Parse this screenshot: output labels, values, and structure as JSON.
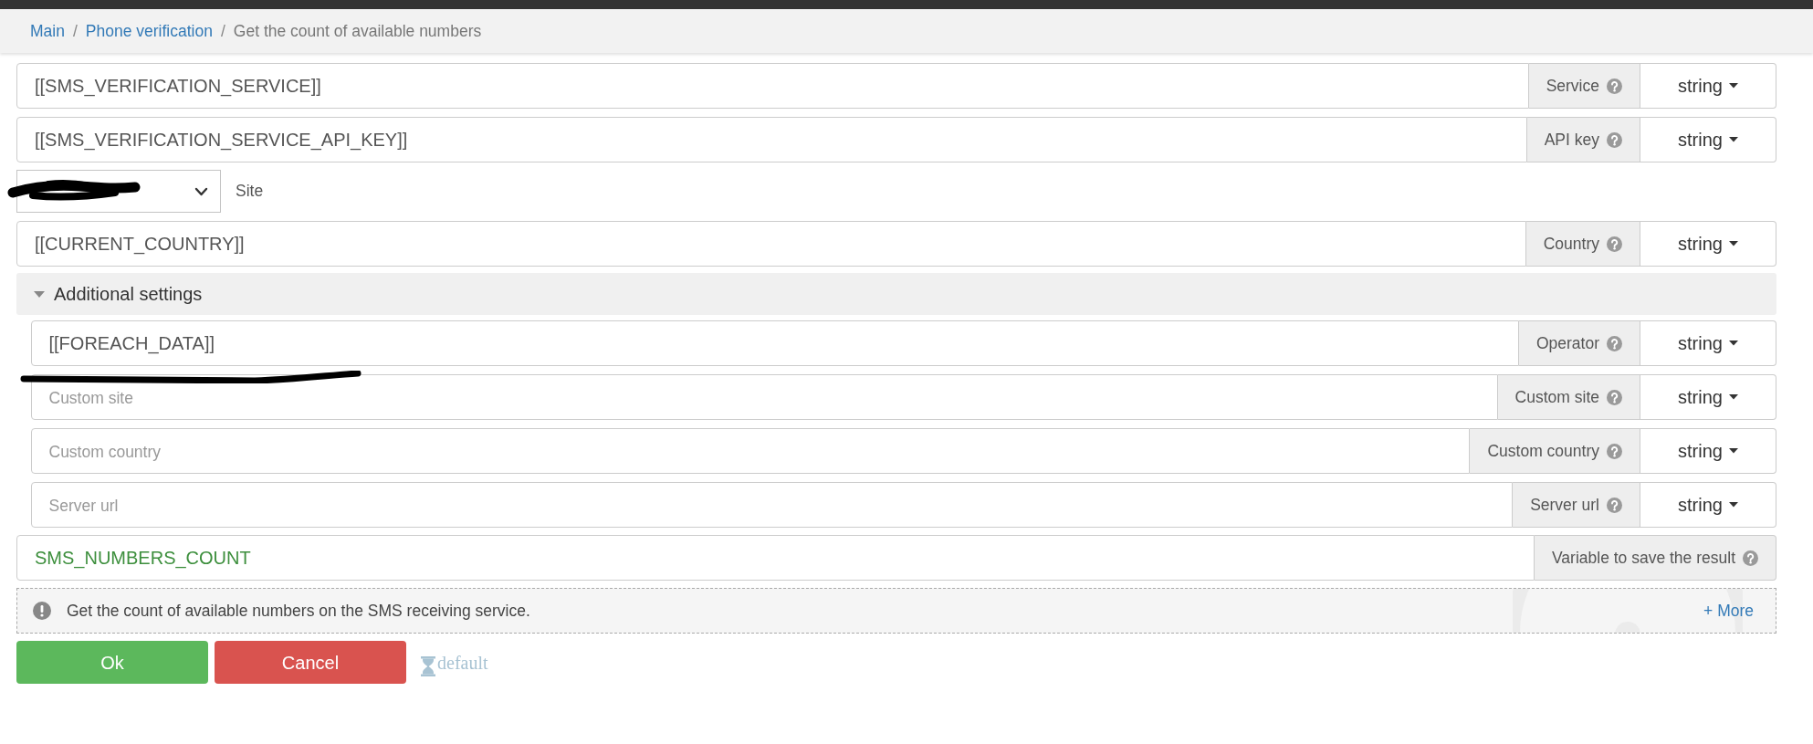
{
  "breadcrumb": [
    {
      "kind": "link",
      "label": "Main"
    },
    {
      "kind": "separator",
      "label": "/"
    },
    {
      "kind": "link",
      "label": "Phone verification"
    },
    {
      "kind": "separator",
      "label": "/"
    },
    {
      "kind": "current",
      "label": "Get the count of available numbers"
    }
  ],
  "fields": [
    {
      "value": "[[SMS_VERIFICATION_SERVICE]]",
      "label": "Service",
      "type": "string"
    },
    {
      "value": "[[SMS_VERIFICATION_SERVICE_API_KEY]]",
      "label": "API key",
      "type": "string"
    }
  ],
  "site_select": {
    "label": "Site",
    "redacted": true
  },
  "country_field": {
    "value": "[[CURRENT_COUNTRY]]",
    "label": "Country",
    "type": "string"
  },
  "additional_settings": {
    "label": "Additional settings",
    "expanded": true,
    "fields": [
      {
        "value": "[[FOREACH_DATA]]",
        "label": "Operator",
        "type": "string",
        "redacted": true
      },
      {
        "placeholder": "Custom site",
        "label": "Custom site",
        "type": "string",
        "redacted": false
      },
      {
        "placeholder": "Custom country",
        "label": "Custom country",
        "type": "string",
        "redacted": false
      },
      {
        "placeholder": "Server url",
        "label": "Server url",
        "type": "string",
        "redacted": false
      }
    ]
  },
  "result_variable": {
    "value": "SMS_NUMBERS_COUNT",
    "label": "Variable to save the result"
  },
  "info": {
    "text": "Get the count of available numbers on the SMS receiving service.",
    "more_link": "+ More"
  },
  "buttons": [
    {
      "kind": "ok",
      "label": "Ok"
    },
    {
      "kind": "cancel",
      "label": "Cancel"
    }
  ],
  "default_link": {
    "label": "default"
  }
}
